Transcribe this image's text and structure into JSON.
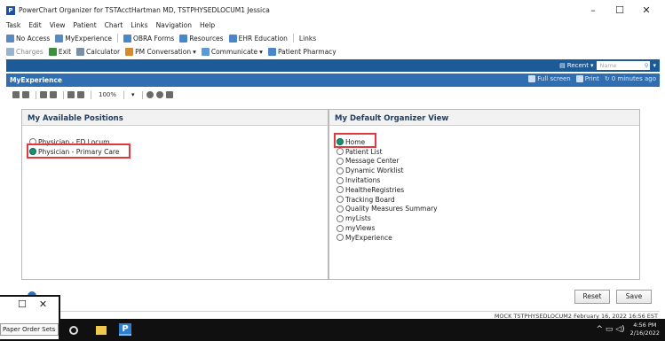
{
  "window": {
    "title": "PowerChart Organizer for TSTAcctHartman MD, TSTPHYSEDLOCUM1 Jessica",
    "controls": [
      "–",
      "☐",
      "✕"
    ]
  },
  "menu": [
    "Task",
    "Edit",
    "View",
    "Patient",
    "Chart",
    "Links",
    "Navigation",
    "Help"
  ],
  "toolbar1": {
    "no_access": "No Access",
    "my_experience": "MyExperience",
    "obra_forms": "OBRA Forms",
    "resources": "Resources",
    "ehr_education": "EHR Education",
    "links": "Links"
  },
  "toolbar2": {
    "charges": "Charges",
    "exit": "Exit",
    "calculator": "Calculator",
    "pm_conversation": "PM Conversation",
    "communicate": "Communicate",
    "patient_pharmacy": "Patient Pharmacy"
  },
  "topbar": {
    "recent": "Recent",
    "name_placeholder": "Name"
  },
  "header": {
    "title": "MyExperience",
    "full_screen": "Full screen",
    "print": "Print",
    "refresh": "0 minutes ago"
  },
  "subtoolbar": {
    "zoom": "100%"
  },
  "positions": {
    "heading": "My Available Positions",
    "items": [
      {
        "label": "Physician - ED Locum",
        "selected": false
      },
      {
        "label": "Physician - Primary Care",
        "selected": true
      }
    ]
  },
  "organizer": {
    "heading": "My Default Organizer View",
    "items": [
      {
        "label": "Home",
        "selected": true
      },
      {
        "label": "Patient List",
        "selected": false
      },
      {
        "label": "Message Center",
        "selected": false
      },
      {
        "label": "Dynamic Worklist",
        "selected": false
      },
      {
        "label": "Invitations",
        "selected": false
      },
      {
        "label": "HealtheRegistries",
        "selected": false
      },
      {
        "label": "Tracking Board",
        "selected": false
      },
      {
        "label": "Quality Measures Summary",
        "selected": false
      },
      {
        "label": "myLists",
        "selected": false
      },
      {
        "label": "myViews",
        "selected": false
      },
      {
        "label": "MyExperience",
        "selected": false
      }
    ]
  },
  "buttons": {
    "reset": "Reset",
    "save": "Save"
  },
  "status": {
    "text": "MOCK TSTPHYSEDLOCUM2 February 16, 2022 16:56 EST"
  },
  "taskbar": {
    "time": "4:56 PM",
    "date": "2/16/2022"
  },
  "popup": {
    "item": "Paper Order Sets"
  },
  "colors": {
    "blue_bar": "#1d5a98",
    "header_bar": "#2f6fb1",
    "radio_selected": "#1a8f72",
    "highlight": "#e0393e"
  }
}
